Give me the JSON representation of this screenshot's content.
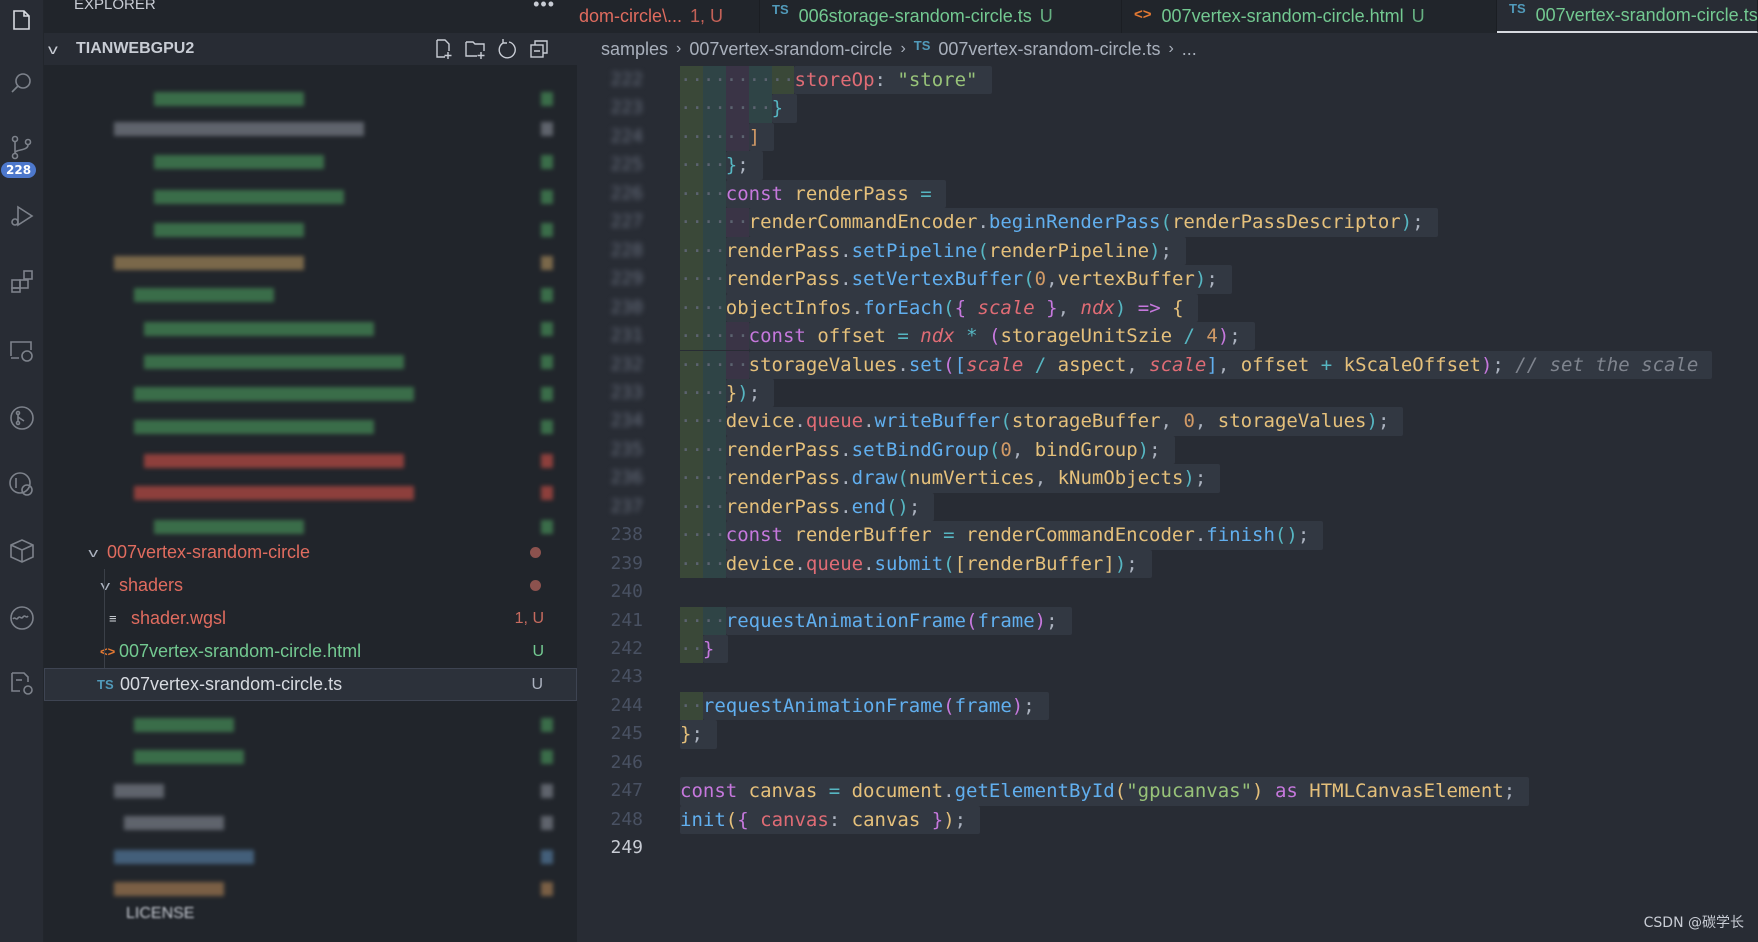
{
  "activity_bar": {
    "items": [
      "files-icon",
      "search-icon",
      "source-control-icon",
      "run-debug-icon",
      "extensions-icon",
      "remote-explorer-icon",
      "git-graph-icon",
      "git-history-icon",
      "package-icon",
      "wave-icon",
      "settings-sync-icon"
    ],
    "source_control_badge": "228"
  },
  "sidebar": {
    "title": "EXPLORER",
    "more": "•••",
    "workspace": "TIANWEBGPU2",
    "tree": [
      {
        "label": "007vertex-srandom-circle",
        "type": "folder",
        "color": "#e06c5f"
      },
      {
        "label": "shaders",
        "type": "folder",
        "color": "#e06c5f"
      },
      {
        "label": "shader.wgsl",
        "type": "file",
        "icon": "≡",
        "color": "#e06c5f",
        "status": "1, U"
      },
      {
        "label": "007vertex-srandom-circle.html",
        "type": "file",
        "icon": "<>",
        "color": "#73c991",
        "status": "U"
      },
      {
        "label": "007vertex-srandom-circle.ts",
        "type": "file",
        "icon": "TS",
        "color": "#d7dae0",
        "status": "U"
      }
    ],
    "license": "LICENSE"
  },
  "tabs": [
    {
      "label": "dom-circle\\...",
      "status": "1, U",
      "color": "#e06c5f",
      "icon": ""
    },
    {
      "label": "006storage-srandom-circle.ts",
      "status": "U",
      "color": "#73c991",
      "icon": "TS"
    },
    {
      "label": "007vertex-srandom-circle.html",
      "status": "U",
      "color": "#73c991",
      "icon": "<>"
    },
    {
      "label": "007vertex-srandom-circle.ts",
      "status": "U",
      "color": "#73c991",
      "icon": "TS",
      "active": true
    }
  ],
  "breadcrumb": [
    "samples",
    "007vertex-srandom-circle",
    "007vertex-srandom-circle.ts",
    "..."
  ],
  "breadcrumb_file_icon": "TS",
  "editor": {
    "active_line": 249,
    "lines": [
      {
        "n": "222",
        "i": 10,
        "t": [
          [
            "storeOp",
            "prop"
          ],
          [
            ": ",
            "pn"
          ],
          [
            "\"store\"",
            "str"
          ]
        ]
      },
      {
        "n": "223",
        "i": 8,
        "t": [
          [
            "}",
            "b2"
          ]
        ]
      },
      {
        "n": "224",
        "i": 6,
        "t": [
          [
            "]",
            "num"
          ]
        ]
      },
      {
        "n": "225",
        "i": 4,
        "t": [
          [
            "}",
            "b2"
          ],
          [
            ";",
            "pn"
          ]
        ]
      },
      {
        "n": "226",
        "i": 4,
        "t": [
          [
            "const",
            "kw"
          ],
          [
            " renderPass ",
            "var"
          ],
          [
            "=",
            "op"
          ]
        ]
      },
      {
        "n": "227",
        "i": 6,
        "t": [
          [
            "renderCommandEncoder",
            "var"
          ],
          [
            ".",
            "pn"
          ],
          [
            "beginRenderPass",
            "fn"
          ],
          [
            "(",
            "b2"
          ],
          [
            "renderPassDescriptor",
            "var"
          ],
          [
            ")",
            "b2"
          ],
          [
            ";",
            "pn"
          ]
        ]
      },
      {
        "n": "228",
        "i": 4,
        "t": [
          [
            "renderPass",
            "var"
          ],
          [
            ".",
            "pn"
          ],
          [
            "setPipeline",
            "fn"
          ],
          [
            "(",
            "b2"
          ],
          [
            "renderPipeline",
            "var"
          ],
          [
            ")",
            "b2"
          ],
          [
            ";",
            "pn"
          ]
        ]
      },
      {
        "n": "229",
        "i": 4,
        "t": [
          [
            "renderPass",
            "var"
          ],
          [
            ".",
            "pn"
          ],
          [
            "setVertexBuffer",
            "fn"
          ],
          [
            "(",
            "b2"
          ],
          [
            "0",
            "num"
          ],
          [
            ",",
            "pn"
          ],
          [
            "vertexBuffer",
            "var"
          ],
          [
            ")",
            "b2"
          ],
          [
            ";",
            "pn"
          ]
        ]
      },
      {
        "n": "230",
        "i": 4,
        "t": [
          [
            "objectInfos",
            "var"
          ],
          [
            ".",
            "pn"
          ],
          [
            "forEach",
            "fn"
          ],
          [
            "(",
            "b2"
          ],
          [
            "{",
            "b1"
          ],
          [
            " ",
            "pn"
          ],
          [
            "scale",
            "par"
          ],
          [
            " ",
            "pn"
          ],
          [
            "}",
            "b1"
          ],
          [
            ", ",
            "pn"
          ],
          [
            "ndx",
            "par"
          ],
          [
            ")",
            "b2"
          ],
          [
            " ",
            "pn"
          ],
          [
            "=>",
            "kw"
          ],
          [
            " ",
            "pn"
          ],
          [
            "{",
            "b3"
          ]
        ]
      },
      {
        "n": "231",
        "i": 6,
        "t": [
          [
            "const",
            "kw"
          ],
          [
            " offset ",
            "var"
          ],
          [
            "=",
            "op"
          ],
          [
            " ",
            "pn"
          ],
          [
            "ndx",
            "par"
          ],
          [
            " ",
            "pn"
          ],
          [
            "*",
            "op"
          ],
          [
            " ",
            "pn"
          ],
          [
            "(",
            "b1"
          ],
          [
            "storageUnitSzie ",
            "var"
          ],
          [
            "/",
            "op"
          ],
          [
            " ",
            "pn"
          ],
          [
            "4",
            "num"
          ],
          [
            ")",
            "b1"
          ],
          [
            ";",
            "pn"
          ]
        ]
      },
      {
        "n": "232",
        "i": 6,
        "t": [
          [
            "storageValues",
            "var"
          ],
          [
            ".",
            "pn"
          ],
          [
            "set",
            "fn"
          ],
          [
            "(",
            "b1"
          ],
          [
            "[",
            "b4"
          ],
          [
            "scale",
            "par"
          ],
          [
            " ",
            "pn"
          ],
          [
            "/",
            "op"
          ],
          [
            " aspect",
            "var"
          ],
          [
            ", ",
            "pn"
          ],
          [
            "scale",
            "par"
          ],
          [
            "]",
            "b4"
          ],
          [
            ", ",
            "pn"
          ],
          [
            "offset ",
            "var"
          ],
          [
            "+",
            "op"
          ],
          [
            " kScaleOffset",
            "var"
          ],
          [
            ")",
            "b1"
          ],
          [
            "; ",
            "pn"
          ],
          [
            "// set the scale",
            "cm"
          ]
        ]
      },
      {
        "n": "233",
        "i": 4,
        "t": [
          [
            "}",
            "b3"
          ],
          [
            ")",
            "b2"
          ],
          [
            ";",
            "pn"
          ]
        ]
      },
      {
        "n": "234",
        "i": 4,
        "t": [
          [
            "device",
            "var"
          ],
          [
            ".",
            "pn"
          ],
          [
            "queue",
            "prop"
          ],
          [
            ".",
            "pn"
          ],
          [
            "writeBuffer",
            "fn"
          ],
          [
            "(",
            "b2"
          ],
          [
            "storageBuffer",
            "var"
          ],
          [
            ", ",
            "pn"
          ],
          [
            "0",
            "num"
          ],
          [
            ", ",
            "pn"
          ],
          [
            "storageValues",
            "var"
          ],
          [
            ")",
            "b2"
          ],
          [
            ";",
            "pn"
          ]
        ]
      },
      {
        "n": "235",
        "i": 4,
        "t": [
          [
            "renderPass",
            "var"
          ],
          [
            ".",
            "pn"
          ],
          [
            "setBindGroup",
            "fn"
          ],
          [
            "(",
            "b2"
          ],
          [
            "0",
            "num"
          ],
          [
            ", ",
            "pn"
          ],
          [
            "bindGroup",
            "var"
          ],
          [
            ")",
            "b2"
          ],
          [
            ";",
            "pn"
          ]
        ]
      },
      {
        "n": "236",
        "i": 4,
        "t": [
          [
            "renderPass",
            "var"
          ],
          [
            ".",
            "pn"
          ],
          [
            "draw",
            "fn"
          ],
          [
            "(",
            "b2"
          ],
          [
            "numVertices",
            "var"
          ],
          [
            ", ",
            "pn"
          ],
          [
            "kNumObjects",
            "var"
          ],
          [
            ")",
            "b2"
          ],
          [
            ";",
            "pn"
          ]
        ]
      },
      {
        "n": "237",
        "i": 4,
        "t": [
          [
            "renderPass",
            "var"
          ],
          [
            ".",
            "pn"
          ],
          [
            "end",
            "fn"
          ],
          [
            "(",
            "b2"
          ],
          [
            ")",
            "b2"
          ],
          [
            ";",
            "pn"
          ]
        ]
      },
      {
        "n": "238",
        "i": 4,
        "t": [
          [
            "const",
            "kw"
          ],
          [
            " renderBuffer ",
            "var"
          ],
          [
            "=",
            "op"
          ],
          [
            " renderCommandEncoder",
            "var"
          ],
          [
            ".",
            "pn"
          ],
          [
            "finish",
            "fn"
          ],
          [
            "(",
            "b2"
          ],
          [
            ")",
            "b2"
          ],
          [
            ";",
            "pn"
          ]
        ]
      },
      {
        "n": "239",
        "i": 4,
        "t": [
          [
            "device",
            "var"
          ],
          [
            ".",
            "pn"
          ],
          [
            "queue",
            "prop"
          ],
          [
            ".",
            "pn"
          ],
          [
            "submit",
            "fn"
          ],
          [
            "(",
            "b2"
          ],
          [
            "[",
            "b3"
          ],
          [
            "renderBuffer",
            "var"
          ],
          [
            "]",
            "b3"
          ],
          [
            ")",
            "b2"
          ],
          [
            ";",
            "pn"
          ]
        ]
      },
      {
        "n": "240",
        "i": 0,
        "t": []
      },
      {
        "n": "241",
        "i": 4,
        "t": [
          [
            "requestAnimationFrame",
            "fn"
          ],
          [
            "(",
            "b1"
          ],
          [
            "frame",
            "fn"
          ],
          [
            ")",
            "b1"
          ],
          [
            ";",
            "pn"
          ]
        ]
      },
      {
        "n": "242",
        "i": 2,
        "t": [
          [
            "}",
            "b1"
          ]
        ]
      },
      {
        "n": "243",
        "i": 0,
        "t": []
      },
      {
        "n": "244",
        "i": 2,
        "t": [
          [
            "requestAnimationFrame",
            "fn"
          ],
          [
            "(",
            "b1"
          ],
          [
            "frame",
            "fn"
          ],
          [
            ")",
            "b1"
          ],
          [
            ";",
            "pn"
          ]
        ]
      },
      {
        "n": "245",
        "i": 0,
        "t": [
          [
            "}",
            "b3"
          ],
          [
            ";",
            "pn"
          ]
        ]
      },
      {
        "n": "246",
        "i": 0,
        "t": []
      },
      {
        "n": "247",
        "i": 0,
        "t": [
          [
            "const",
            "kw"
          ],
          [
            " canvas ",
            "var"
          ],
          [
            "=",
            "op"
          ],
          [
            " document",
            "var"
          ],
          [
            ".",
            "pn"
          ],
          [
            "getElementById",
            "fn"
          ],
          [
            "(",
            "b3"
          ],
          [
            "\"gpucanvas\"",
            "str"
          ],
          [
            ")",
            "b3"
          ],
          [
            " ",
            "pn"
          ],
          [
            "as",
            "kw"
          ],
          [
            " HTMLCanvasElement",
            "var"
          ],
          [
            ";",
            "pn"
          ]
        ]
      },
      {
        "n": "248",
        "i": 0,
        "t": [
          [
            "init",
            "fn"
          ],
          [
            "(",
            "b3"
          ],
          [
            "{",
            "b1"
          ],
          [
            " ",
            "pn"
          ],
          [
            "canvas",
            "prop"
          ],
          [
            ": ",
            "pn"
          ],
          [
            "canvas",
            "var"
          ],
          [
            " ",
            "pn"
          ],
          [
            "}",
            "b1"
          ],
          [
            ")",
            "b3"
          ],
          [
            ";",
            "pn"
          ]
        ]
      },
      {
        "n": "249",
        "i": 0,
        "t": []
      }
    ]
  },
  "watermark": "CSDN @碳学长"
}
